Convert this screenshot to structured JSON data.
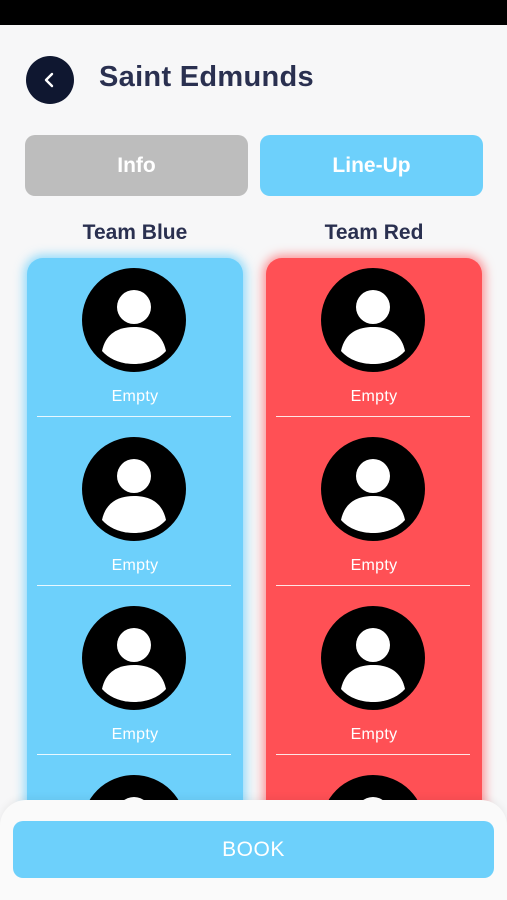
{
  "header": {
    "title": "Saint Edmunds",
    "back_icon": "chevron-left-icon"
  },
  "tabs": [
    {
      "label": "Info",
      "active": false
    },
    {
      "label": "Line-Up",
      "active": true
    }
  ],
  "teams": {
    "blue": {
      "name": "Team Blue",
      "color": "#6dd0fb",
      "slots": [
        "Empty",
        "Empty",
        "Empty"
      ]
    },
    "red": {
      "name": "Team Red",
      "color": "#ff5055",
      "slots": [
        "Empty",
        "Empty",
        "Empty"
      ]
    }
  },
  "footer": {
    "book_label": "BOOK"
  },
  "colors": {
    "accent": "#6dd0fb",
    "inactive_tab": "#bdbdbd",
    "title_text": "#2a3050",
    "back_button_bg": "#0f1730"
  }
}
